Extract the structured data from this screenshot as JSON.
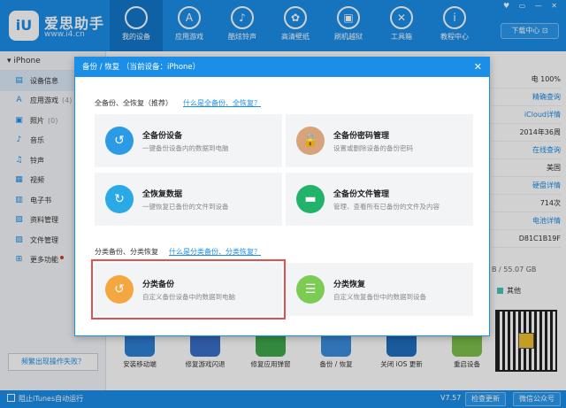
{
  "app": {
    "logo_mark": "iU",
    "name": "爱思助手",
    "url": "www.i4.cn",
    "window_controls": "♥ ▭ — ✕",
    "download_center": "下载中心 ⊡"
  },
  "nav": [
    {
      "label": "我的设备",
      "icon": "apple-icon",
      "glyph": "",
      "active": true
    },
    {
      "label": "应用游戏",
      "icon": "app-store-icon",
      "glyph": "A"
    },
    {
      "label": "酷炫铃声",
      "icon": "bell-icon",
      "glyph": "♪"
    },
    {
      "label": "高清壁纸",
      "icon": "flower-icon",
      "glyph": "✿"
    },
    {
      "label": "刷机越狱",
      "icon": "box-icon",
      "glyph": "▣"
    },
    {
      "label": "工具箱",
      "icon": "tools-icon",
      "glyph": "✕"
    },
    {
      "label": "教程中心",
      "icon": "info-icon",
      "glyph": "i"
    }
  ],
  "sidebar": {
    "device": "▾ iPhone",
    "items": [
      {
        "label": "设备信息",
        "icon": "info-icon",
        "glyph": "▤",
        "count": "",
        "active": true
      },
      {
        "label": "应用游戏",
        "icon": "app-store-icon",
        "glyph": "A",
        "count": "(4)"
      },
      {
        "label": "照片",
        "icon": "photo-icon",
        "glyph": "▣",
        "count": "(0)"
      },
      {
        "label": "音乐",
        "icon": "music-icon",
        "glyph": "♪",
        "count": ""
      },
      {
        "label": "铃声",
        "icon": "bell-icon",
        "glyph": "♫",
        "count": ""
      },
      {
        "label": "视频",
        "icon": "video-icon",
        "glyph": "▦",
        "count": ""
      },
      {
        "label": "电子书",
        "icon": "book-icon",
        "glyph": "▥",
        "count": ""
      },
      {
        "label": "资料管理",
        "icon": "contacts-icon",
        "glyph": "▧",
        "count": ""
      },
      {
        "label": "文件管理",
        "icon": "folder-icon",
        "glyph": "▨",
        "count": ""
      },
      {
        "label": "更多功能",
        "icon": "grid-icon",
        "glyph": "⊞",
        "count": "",
        "badge": true
      }
    ],
    "feedback": "频繁出现操作失败？"
  },
  "device_info": {
    "percent": "电 100%",
    "rows": [
      "精确查询",
      "iCloud详情",
      "2014年36周",
      "在线查询",
      "美国",
      "硬盘详情",
      "714次",
      "电池详情",
      "D81C1B19F"
    ],
    "storage": "B / 55.07 GB",
    "legend_other": "其他"
  },
  "tools": [
    {
      "label": "安装移动端",
      "color": "#2d7fd3"
    },
    {
      "label": "修复游戏闪退",
      "color": "#3a6ec8"
    },
    {
      "label": "修复应用弹窗",
      "color": "#3fa94d"
    },
    {
      "label": "备份 / 恢复",
      "color": "#3b8ee0"
    },
    {
      "label": "关闭 iOS 更新",
      "color": "#1f6fc0"
    },
    {
      "label": "重启设备",
      "color": "#7ec04a"
    }
  ],
  "statusbar": {
    "itunes": "阻止iTunes自动运行",
    "version": "V7.57",
    "check_update": "检查更新",
    "wechat": "微信公众号"
  },
  "modal": {
    "title": "备份 / 恢复   （当前设备：iPhone）",
    "close": "✕",
    "section1": {
      "title": "全备份、全恢复（推荐）",
      "help": "什么是全备份、全恢复？"
    },
    "section2": {
      "title": "分类备份、分类恢复",
      "help": "什么是分类备份、分类恢复？"
    },
    "cards": [
      {
        "title": "全备份设备",
        "desc": "一键备份设备内的数据到电脑",
        "icon": "backup-icon",
        "glyph": "↺",
        "color": "#2c9be6"
      },
      {
        "title": "全备份密码管理",
        "desc": "设置或删除设备的备份密码",
        "icon": "lock-icon",
        "glyph": "🔒",
        "color": "#d8a27a"
      },
      {
        "title": "全恢复数据",
        "desc": "一键恢复已备份的文件到设备",
        "icon": "restore-icon",
        "glyph": "↻",
        "color": "#29a9e6"
      },
      {
        "title": "全备份文件管理",
        "desc": "管理、查看所有已备份的文件及内容",
        "icon": "folder-icon",
        "glyph": "▬",
        "color": "#22b36a"
      },
      {
        "title": "分类备份",
        "desc": "自定义备份设备中的数据到电脑",
        "icon": "category-backup-icon",
        "glyph": "↺",
        "color": "#f4a640"
      },
      {
        "title": "分类恢复",
        "desc": "自定义恢复备份中的数据到设备",
        "icon": "category-restore-icon",
        "glyph": "☰",
        "color": "#7ccb52"
      }
    ]
  }
}
